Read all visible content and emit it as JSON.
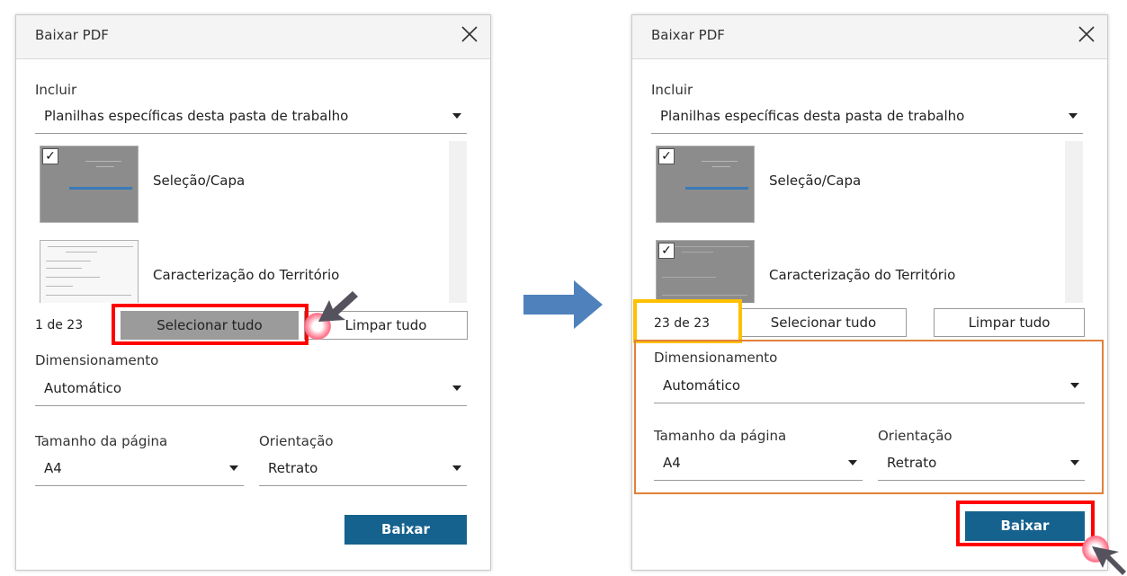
{
  "before": {
    "dialog_title": "Baixar PDF",
    "include_label": "Incluir",
    "include_value": "Planilhas específicas desta pasta de trabalho",
    "sheets": [
      {
        "name": "Seleção/Capa",
        "checked": true
      },
      {
        "name": "Caracterização do Território",
        "checked": false
      }
    ],
    "count": "1 de 23",
    "select_all": "Selecionar tudo",
    "clear_all": "Limpar tudo",
    "scaling_label": "Dimensionamento",
    "scaling_value": "Automático",
    "page_size_label": "Tamanho da página",
    "page_size_value": "A4",
    "orientation_label": "Orientação",
    "orientation_value": "Retrato",
    "download": "Baixar"
  },
  "after": {
    "dialog_title": "Baixar PDF",
    "include_label": "Incluir",
    "include_value": "Planilhas específicas desta pasta de trabalho",
    "sheets": [
      {
        "name": "Seleção/Capa",
        "checked": true
      },
      {
        "name": "Caracterização do Território",
        "checked": true
      }
    ],
    "count": "23 de 23",
    "select_all": "Selecionar tudo",
    "clear_all": "Limpar tudo",
    "scaling_label": "Dimensionamento",
    "scaling_value": "Automático",
    "page_size_label": "Tamanho da página",
    "page_size_value": "A4",
    "orientation_label": "Orientação",
    "orientation_value": "Retrato",
    "download": "Baixar"
  },
  "colors": {
    "primary_button": "#15628e",
    "highlight_red": "#ff0000",
    "highlight_yellow": "#ffc000",
    "bracket_orange": "#e1803a",
    "arrow_blue": "#4f81bd"
  },
  "icons": [
    "close-icon",
    "chevron-down-icon",
    "checkbox-icon",
    "right-arrow-icon",
    "cursor-icon"
  ]
}
